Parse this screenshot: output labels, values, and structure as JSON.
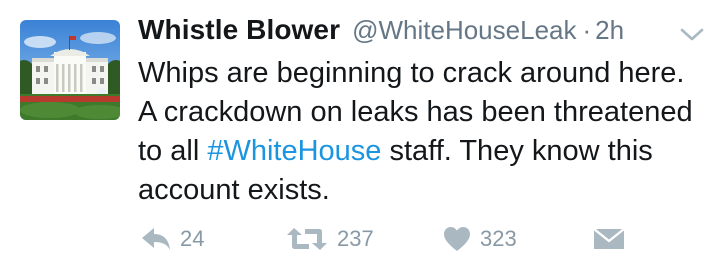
{
  "tweet": {
    "display_name": "Whistle Blower",
    "handle": "@WhiteHouseLeak",
    "separator": "·",
    "time": "2h",
    "text_before": "Whips are beginning to crack around here. A crackdown on leaks has been threatened to all ",
    "hashtag": "#WhiteHouse",
    "text_after": " staff. They know this account exists."
  },
  "actions": {
    "reply_count": "24",
    "retweet_count": "237",
    "like_count": "323"
  },
  "icons": {
    "avatar": "white-house-photo",
    "caret": "chevron-down-icon",
    "reply": "reply-icon",
    "retweet": "retweet-icon",
    "like": "heart-icon",
    "dm": "envelope-icon"
  },
  "colors": {
    "hashtag": "#1b95e0",
    "meta": "#657786",
    "icon": "#aab8c2"
  }
}
